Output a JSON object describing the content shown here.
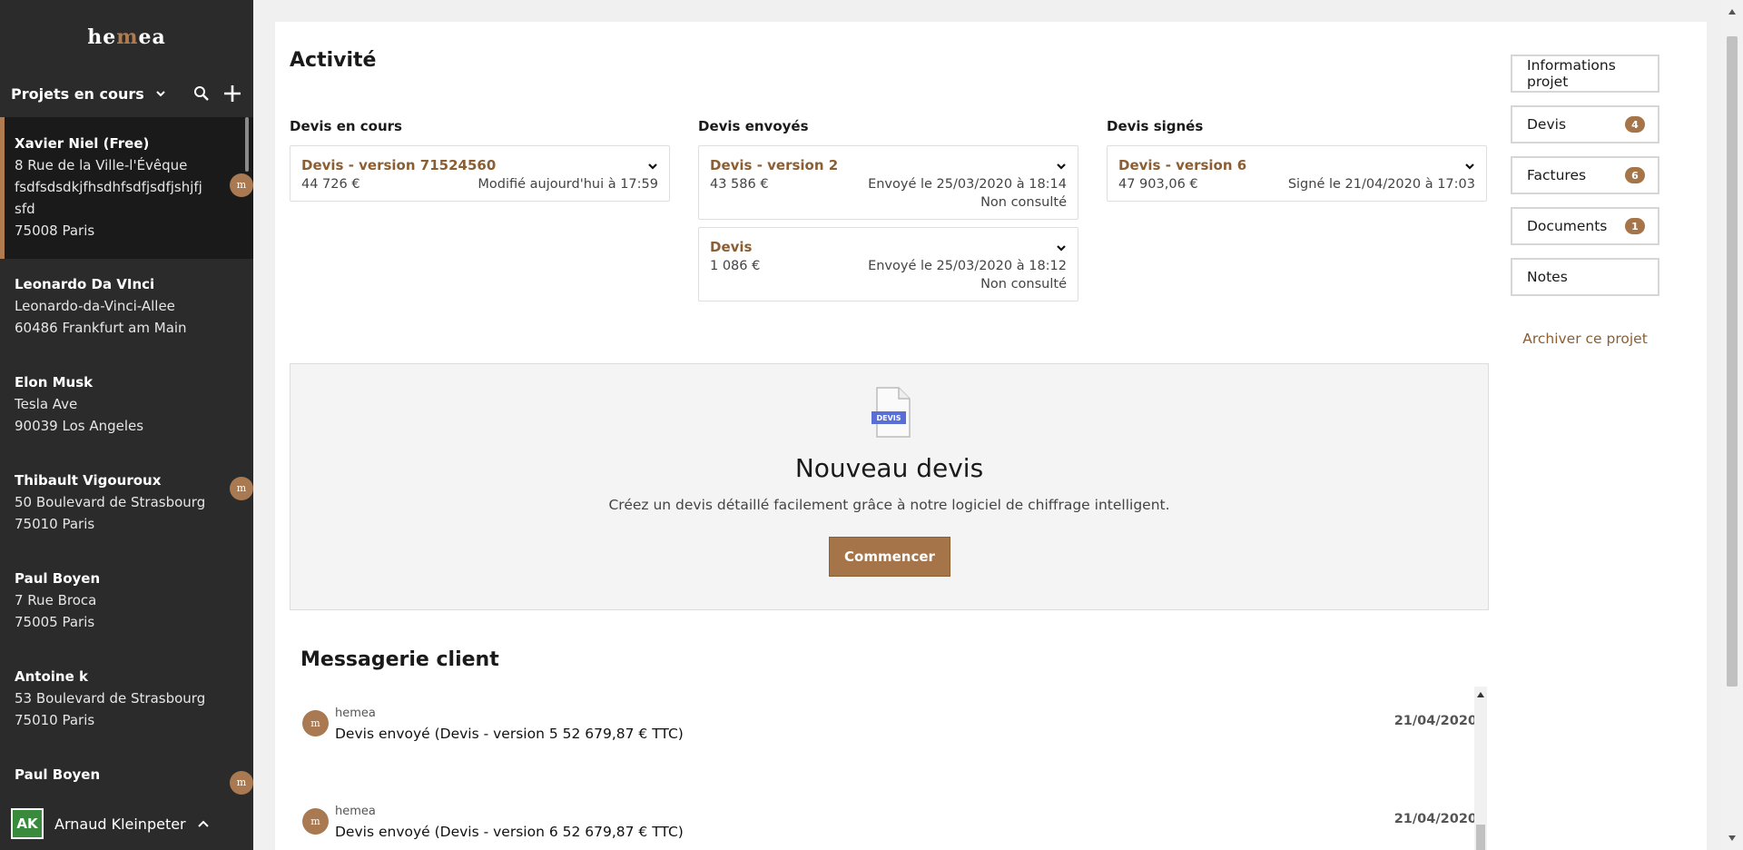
{
  "app": {
    "logo_pre": "he",
    "logo_accent": "m",
    "logo_post": "ea"
  },
  "sidebar": {
    "section_title": "Projets en cours",
    "projects": [
      {
        "name": "Xavier Niel (Free)",
        "lines": [
          "8 Rue de la Ville-l'Évêque",
          "fsdfsdsdkjfhsdhfsdfjsdfjshjfj",
          "sfd",
          "75008 Paris"
        ],
        "badge": "m",
        "active": true
      },
      {
        "name": "Leonardo Da VInci",
        "lines": [
          "Leonardo-da-Vinci-Allee",
          "60486 Frankfurt am Main"
        ],
        "badge": "",
        "active": false
      },
      {
        "name": "Elon Musk",
        "lines": [
          "Tesla Ave",
          "90039 Los Angeles"
        ],
        "badge": "",
        "active": false
      },
      {
        "name": "Thibault Vigouroux",
        "lines": [
          "50 Boulevard de Strasbourg",
          "75010 Paris"
        ],
        "badge": "m",
        "active": false
      },
      {
        "name": "Paul Boyen",
        "lines": [
          "7 Rue Broca",
          "75005 Paris"
        ],
        "badge": "",
        "active": false
      },
      {
        "name": "Antoine k",
        "lines": [
          "53 Boulevard de Strasbourg",
          "75010 Paris"
        ],
        "badge": "",
        "active": false
      },
      {
        "name": "Paul Boyen",
        "lines": [],
        "badge": "m",
        "active": false
      }
    ],
    "user": {
      "initials": "AK",
      "name": "Arnaud Kleinpeter"
    }
  },
  "activity": {
    "title": "Activité",
    "columns": [
      {
        "title": "Devis en cours",
        "cards": [
          {
            "title": "Devis - version 71524560",
            "amount": "44 726 €",
            "status": "Modifié aujourd'hui à 17:59",
            "sub": ""
          }
        ]
      },
      {
        "title": "Devis envoyés",
        "cards": [
          {
            "title": "Devis - version 2",
            "amount": "43 586 €",
            "status": "Envoyé le 25/03/2020 à 18:14",
            "sub": "Non consulté"
          },
          {
            "title": "Devis",
            "amount": "1 086 €",
            "status": "Envoyé le 25/03/2020 à 18:12",
            "sub": "Non consulté"
          }
        ]
      },
      {
        "title": "Devis signés",
        "cards": [
          {
            "title": "Devis - version 6",
            "amount": "47 903,06 €",
            "status": "Signé le 21/04/2020 à 17:03",
            "sub": ""
          }
        ]
      }
    ]
  },
  "nouveau_devis": {
    "icon_label": "DEVIS",
    "title": "Nouveau devis",
    "description": "Créez un devis détaillé facilement grâce à notre logiciel de chiffrage intelligent.",
    "button": "Commencer"
  },
  "messagerie": {
    "title": "Messagerie client",
    "messages": [
      {
        "author": "hemea",
        "text": "Devis envoyé (Devis - version 5 52 679,87 € TTC)",
        "date": "21/04/2020"
      },
      {
        "author": "hemea",
        "text": "Devis envoyé (Devis - version 6 52 679,87 € TTC)",
        "date": "21/04/2020"
      }
    ]
  },
  "right_nav": {
    "items": [
      {
        "label": "Informations projet",
        "count": ""
      },
      {
        "label": "Devis",
        "count": "4"
      },
      {
        "label": "Factures",
        "count": "6"
      },
      {
        "label": "Documents",
        "count": "1"
      },
      {
        "label": "Notes",
        "count": ""
      }
    ],
    "archive": "Archiver ce projet"
  },
  "colors": {
    "sidebar_bg": "#2b2b2b",
    "accent": "#a57549",
    "accent_text": "#8b5e34"
  }
}
